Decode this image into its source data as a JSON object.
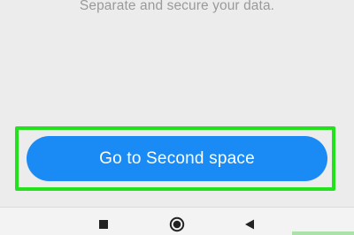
{
  "header": {
    "subtitle": "Separate and secure your data."
  },
  "actions": {
    "primary_label": "Go to Second space",
    "primary_color": "#1a8bf4",
    "highlight_color": "#22e21b"
  },
  "navbar": {
    "recents_icon": "square-icon",
    "home_icon": "circle-icon",
    "back_icon": "triangle-back-icon"
  }
}
